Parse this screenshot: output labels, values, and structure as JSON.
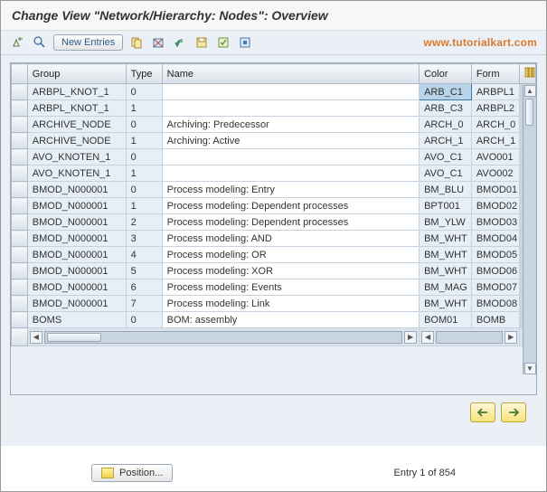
{
  "title": "Change View \"Network/Hierarchy: Nodes\": Overview",
  "toolbar": {
    "new_entries_label": "New Entries"
  },
  "watermark": "www.tutorialkart.com",
  "table": {
    "headers": {
      "group": "Group",
      "type": "Type",
      "name": "Name",
      "color": "Color",
      "form": "Form"
    },
    "rows": [
      {
        "group": "ARBPL_KNOT_1",
        "type": "0",
        "name": "",
        "color": "ARB_C1",
        "form": "ARBPL1",
        "sel_color": true
      },
      {
        "group": "ARBPL_KNOT_1",
        "type": "1",
        "name": "",
        "color": "ARB_C3",
        "form": "ARBPL2"
      },
      {
        "group": "ARCHIVE_NODE",
        "type": "0",
        "name": "Archiving: Predecessor",
        "color": "ARCH_0",
        "form": "ARCH_0"
      },
      {
        "group": "ARCHIVE_NODE",
        "type": "1",
        "name": "Archiving: Active",
        "color": "ARCH_1",
        "form": "ARCH_1"
      },
      {
        "group": "AVO_KNOTEN_1",
        "type": "0",
        "name": "",
        "color": "AVO_C1",
        "form": "AVO001"
      },
      {
        "group": "AVO_KNOTEN_1",
        "type": "1",
        "name": "",
        "color": "AVO_C1",
        "form": "AVO002"
      },
      {
        "group": "BMOD_N000001",
        "type": "0",
        "name": "Process modeling: Entry",
        "color": "BM_BLU",
        "form": "BMOD01"
      },
      {
        "group": "BMOD_N000001",
        "type": "1",
        "name": "Process modeling: Dependent processes",
        "color": "BPT001",
        "form": "BMOD02"
      },
      {
        "group": "BMOD_N000001",
        "type": "2",
        "name": "Process modeling: Dependent processes",
        "color": "BM_YLW",
        "form": "BMOD03"
      },
      {
        "group": "BMOD_N000001",
        "type": "3",
        "name": "Process modeling: AND",
        "color": "BM_WHT",
        "form": "BMOD04"
      },
      {
        "group": "BMOD_N000001",
        "type": "4",
        "name": "Process modeling: OR",
        "color": "BM_WHT",
        "form": "BMOD05"
      },
      {
        "group": "BMOD_N000001",
        "type": "5",
        "name": "Process modeling: XOR",
        "color": "BM_WHT",
        "form": "BMOD06"
      },
      {
        "group": "BMOD_N000001",
        "type": "6",
        "name": "Process modeling: Events",
        "color": "BM_MAG",
        "form": "BMOD07"
      },
      {
        "group": "BMOD_N000001",
        "type": "7",
        "name": "Process modeling: Link",
        "color": "BM_WHT",
        "form": "BMOD08"
      },
      {
        "group": "BOMS",
        "type": "0",
        "name": "BOM: assembly",
        "color": "BOM01",
        "form": "BOMB"
      }
    ]
  },
  "footer": {
    "position_label": "Position...",
    "entry_label": "Entry 1 of 854"
  }
}
